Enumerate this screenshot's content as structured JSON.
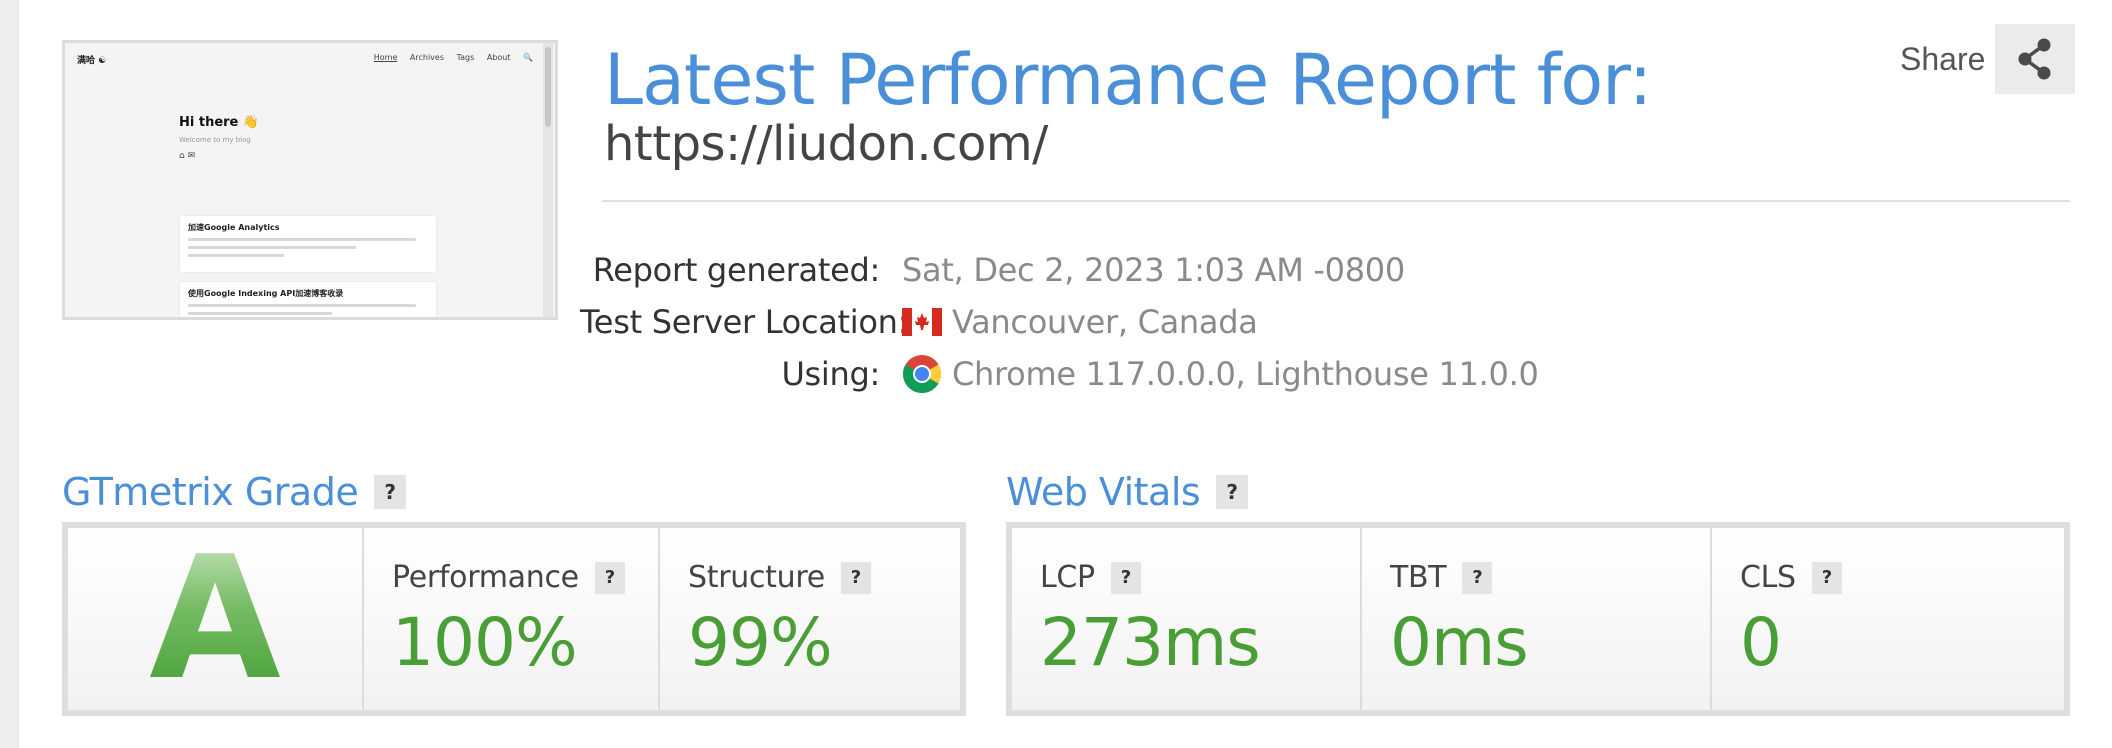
{
  "thumbnail": {
    "site_logo": "满哈 ☯",
    "nav": [
      "Home",
      "Archives",
      "Tags",
      "About",
      "🔍"
    ],
    "greeting": "Hi there 👋",
    "tagline": "Welcome to my blog",
    "icons": "⌂ ✉",
    "posts": [
      "加速Google Analytics",
      "使用Google Indexing API加速博客收录"
    ]
  },
  "header": {
    "title": "Latest Performance Report for:",
    "url": "https://liudon.com/",
    "share_label": "Share"
  },
  "meta": {
    "generated_label": "Report generated:",
    "generated_value": "Sat, Dec 2, 2023 1:03 AM -0800",
    "location_label": "Test Server Location:",
    "location_value": "Vancouver, Canada",
    "using_label": "Using:",
    "using_value": "Chrome 117.0.0.0, Lighthouse 11.0.0"
  },
  "grade": {
    "title": "GTmetrix Grade",
    "help": "?",
    "letter": "A",
    "performance_label": "Performance",
    "performance_value": "100%",
    "structure_label": "Structure",
    "structure_value": "99%"
  },
  "vitals": {
    "title": "Web Vitals",
    "help": "?",
    "lcp_label": "LCP",
    "lcp_value": "273ms",
    "tbt_label": "TBT",
    "tbt_value": "0ms",
    "cls_label": "CLS",
    "cls_value": "0"
  },
  "colors": {
    "accent_blue": "#4a8fd8",
    "good_green": "#4a9e36",
    "panel_border": "#dedede"
  }
}
